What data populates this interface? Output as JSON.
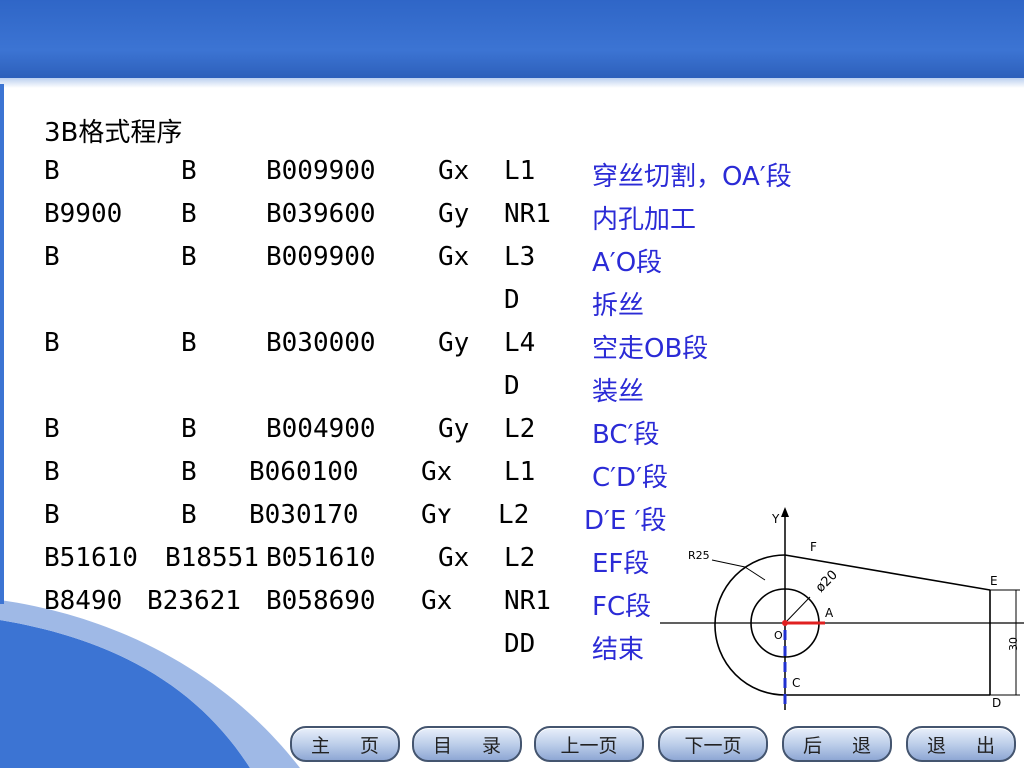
{
  "title": "3B格式程序",
  "rows": [
    {
      "c1": "B",
      "c2": "B",
      "c3": "B009900",
      "c4": "Gx",
      "c5": "L1",
      "note": "穿丝切割，OA′段"
    },
    {
      "c1": "B9900",
      "c2": "B",
      "c3": "B039600",
      "c4": "Gy",
      "c5": "NR1",
      "note": "内孔加工"
    },
    {
      "c1": "B",
      "c2": "B",
      "c3": "B009900",
      "c4": "Gx",
      "c5": "L3",
      "note": "A′O段"
    },
    {
      "c1": "",
      "c2": "",
      "c3": "",
      "c4": "",
      "c5": "D",
      "note": "拆丝"
    },
    {
      "c1": "B",
      "c2": "B",
      "c3": "B030000",
      "c4": "Gy",
      "c5": "L4",
      "note": "空走OB段"
    },
    {
      "c1": "",
      "c2": "",
      "c3": "",
      "c4": "",
      "c5": "D",
      "note": "装丝"
    },
    {
      "c1": "B",
      "c2": "B",
      "c3": "B004900",
      "c4": "Gy",
      "c5": "L2",
      "note": "BC′段"
    },
    {
      "c1": "B",
      "c2": "B",
      "c3": "B060100",
      "c4": "Gx",
      "c5": "L1",
      "note": "C′D′段"
    },
    {
      "c1": "B",
      "c2": "B",
      "c3": "B030170",
      "c4": "Gʏ",
      "c5": "L2",
      "note": "D′E ′段"
    },
    {
      "c1": "B51610",
      "c2": "B18551",
      "c3": "B051610",
      "c4": "Gx",
      "c5": "L2",
      "note": "EF段"
    },
    {
      "c1": "B8490",
      "c2": "B23621",
      "c3": "B058690",
      "c4": "Gx",
      "c5": "NR1",
      "note": "FC段"
    },
    {
      "c1": "",
      "c2": "",
      "c3": "",
      "c4": "",
      "c5": "DD",
      "note": "结束"
    }
  ],
  "drawing": {
    "labels": {
      "r25": "R25",
      "phi20": "ø20",
      "y": "Y",
      "f": "F",
      "e": "E",
      "a": "A",
      "o": "O",
      "c": "C",
      "d": "D",
      "dim30": "30"
    }
  },
  "nav": {
    "home": "主 页",
    "contents": "目 录",
    "prev": "上一页",
    "next": "下一页",
    "back": "后 退",
    "exit": "退 出"
  },
  "colors": {
    "header": "#3c74d3",
    "note": "#2b2bd6",
    "accent_red": "#e02020",
    "accent_blue": "#2030d0"
  }
}
